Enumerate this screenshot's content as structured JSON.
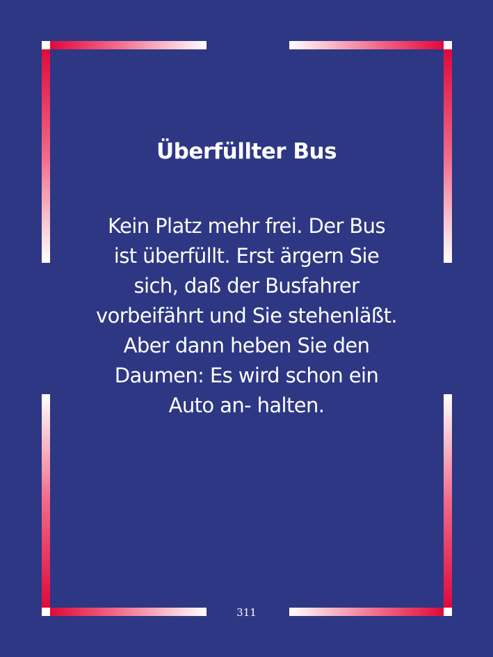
{
  "card": {
    "title": "Überfüllter Bus",
    "body_lines": [
      "Kein Platz mehr frei. Der Bus",
      "ist überfüllt. Erst ärgern Sie",
      "sich, daß der Busfahrer",
      "vorbeifährt und Sie stehenläßt.",
      "Aber dann heben Sie den",
      "Daumen: Es wird schon ein",
      "Auto an- halten."
    ],
    "page_number": "311"
  },
  "colors": {
    "background": "#2e3783",
    "frame_accent": "#e0093a",
    "frame_light": "#ffffff",
    "text": "#ffffff"
  }
}
